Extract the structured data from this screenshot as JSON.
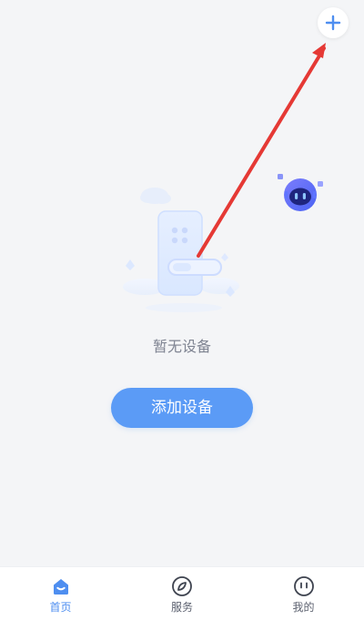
{
  "empty_state": {
    "text": "暂无设备",
    "button_label": "添加设备"
  },
  "tabs": [
    {
      "label": "首页",
      "icon": "home-icon",
      "active": true
    },
    {
      "label": "服务",
      "icon": "compass-icon",
      "active": false
    },
    {
      "label": "我的",
      "icon": "profile-face-icon",
      "active": false
    }
  ],
  "colors": {
    "page_background": "#f4f5f7",
    "primary": "#5b9bf6",
    "active_tab": "#4e8ef0",
    "arrow": "#e53935",
    "muted_text": "#7f8492"
  }
}
